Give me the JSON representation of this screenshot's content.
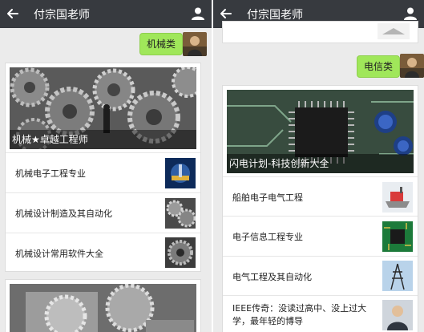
{
  "left_screen": {
    "header": {
      "title": "付宗国老师"
    },
    "message": {
      "text": "机械类"
    },
    "card1": {
      "hero_caption": "机械★卓越工程师",
      "items": [
        {
          "label": "机械电子工程专业",
          "thumb_icon": "robot-arm-image"
        },
        {
          "label": "机械设计制造及其自动化",
          "thumb_icon": "gears-image"
        },
        {
          "label": "机械设计常用软件大全",
          "thumb_icon": "gear-closeup-image"
        }
      ]
    },
    "card2": {
      "hero_icon": "machinery-image"
    }
  },
  "right_screen": {
    "header": {
      "title": "付宗国老师"
    },
    "message": {
      "text": "电信类"
    },
    "card1": {
      "hero_caption": "闪电计划-科技创新大全",
      "items": [
        {
          "label": "船舶电子电气工程",
          "thumb_icon": "ship-image"
        },
        {
          "label": "电子信息工程专业",
          "thumb_icon": "circuit-board-image"
        },
        {
          "label": "电气工程及其自动化",
          "thumb_icon": "power-tower-image"
        },
        {
          "label": "IEEE传奇：没读过高中、没上过大学，最年轻的博导",
          "thumb_icon": "person-photo"
        }
      ]
    }
  },
  "colors": {
    "topbar": "#373a3f",
    "bubble": "#a0e75a",
    "background": "#ebebeb"
  }
}
